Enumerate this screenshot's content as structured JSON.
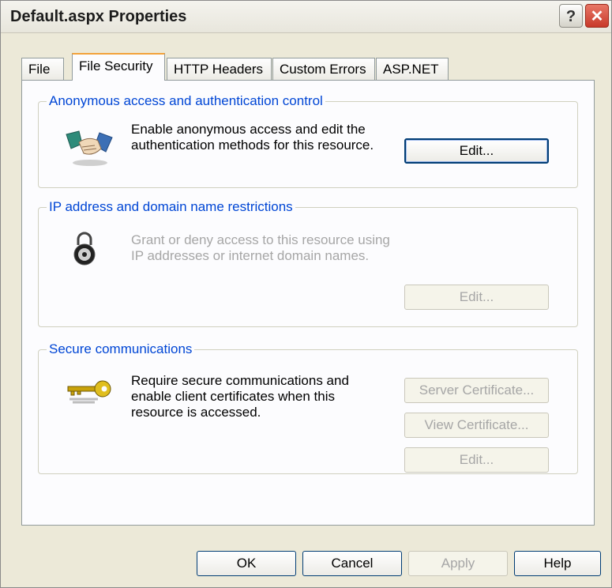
{
  "window": {
    "title": "Default.aspx Properties",
    "help_label": "?",
    "close_label": "✕"
  },
  "tabs": [
    {
      "label": "File",
      "active": false
    },
    {
      "label": "File Security",
      "active": true
    },
    {
      "label": "HTTP Headers",
      "active": false
    },
    {
      "label": "Custom Errors",
      "active": false
    },
    {
      "label": "ASP.NET",
      "active": false
    }
  ],
  "anonymous": {
    "legend": "Anonymous access and authentication control",
    "line1": "Enable anonymous access and edit the",
    "line2": "authentication methods for this resource.",
    "edit_label": "Edit...",
    "icon": "handshake-icon"
  },
  "ip": {
    "legend": "IP address and domain name restrictions",
    "line1": "Grant or deny access to this resource using",
    "line2": "IP addresses or internet domain names.",
    "edit_label": "Edit...",
    "icon": "padlock-icon"
  },
  "secure": {
    "legend": "Secure communications",
    "line1": "Require secure communications and",
    "line2": "enable client certificates when this",
    "line3": "resource is accessed.",
    "server_cert_label": "Server Certificate...",
    "view_cert_label": "View Certificate...",
    "edit_label": "Edit...",
    "icon": "key-icon"
  },
  "footer": {
    "ok_label": "OK",
    "cancel_label": "Cancel",
    "apply_label": "Apply",
    "help_label": "Help"
  },
  "colors": {
    "dialog_bg": "#ece9d8",
    "legend_text": "#0046d5",
    "active_tab_accent": "#f2a23a",
    "disabled_text": "#a6a6a6"
  }
}
